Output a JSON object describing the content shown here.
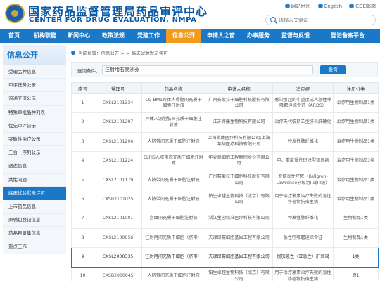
{
  "header": {
    "title_cn": "国家药品监督管理局药品审评中心",
    "title_en": "CENTER FOR DRUG EVALUATION, NMPA",
    "links": [
      "网站地图",
      "English",
      "CDE邮箱"
    ],
    "search_placeholder": "请输入关键词"
  },
  "nav": [
    {
      "label": "首页",
      "w": 40
    },
    {
      "label": "机构职能",
      "w": 48
    },
    {
      "label": "新闻中心",
      "w": 48
    },
    {
      "label": "政策法规",
      "w": 50
    },
    {
      "label": "党建工作",
      "w": 50
    },
    {
      "label": "信息公开",
      "w": 50
    },
    {
      "label": "申请人之窗",
      "w": 56
    },
    {
      "label": "办事服务",
      "w": 50
    },
    {
      "label": "监督与反馈",
      "w": 56
    },
    {
      "label": "登记备案平台",
      "w": 92
    }
  ],
  "nav_active": 5,
  "sidebar": {
    "title": "信息公开",
    "items": [
      "受理品种信息",
      "审评任务公示",
      "沟通交流公示",
      "特殊审批品种列表",
      "优先审评公示",
      "突破性治疗公示",
      "三合一序列公示",
      "送达信息",
      "共性问题",
      "临床试验默示许可",
      "上市药品信息",
      "原辅包登记信息",
      "药品目录集信息",
      "重点工作"
    ],
    "active": 9
  },
  "breadcrumb": "当前位置：信息公开 > > 临床试验默示许可",
  "query": {
    "label": "查询条件：",
    "value": "注射用右美沙芬",
    "button": "查询"
  },
  "table": {
    "headers": [
      "序号",
      "受理号",
      "药品名称",
      "申请人名称",
      "适应症",
      "注册分类"
    ],
    "rows": [
      [
        "1",
        "CXSL2101334",
        "CG-BM1异体人骨髓间充质干细胞注射液",
        "广州赛莱拉干细胞科技股份有限公司",
        "感染引起的中重度成人急性呼吸窘迫综合征（ARDS）",
        "治疗用生物制品1类"
      ],
      [
        "2",
        "CXSL2101297",
        "异体人源脂肪间充质干细胞注射液",
        "江苏得康生物科技有限公司",
        "治疗失代偿期乙型肝炎肝硬化",
        "治疗用生物制品1类"
      ],
      [
        "3",
        "CXSL2101296",
        "人脐带间充质干细胞注射液",
        "上海莱馥医疗科技有限公司;上海莱馥医疗科技有限公司",
        "特发性肺纤维化",
        "治疗用生物制品1类"
      ],
      [
        "4",
        "CXSL2101224",
        "ELPIS人脐带间充质干细胞注射液",
        "华夏源细胞工程集团股份有限公司",
        "中、重度慢性斑块型银屑病",
        "治疗用生物制品1类"
      ],
      [
        "5",
        "CXSL2101179",
        "人脐带间充质干细胞注射液",
        "广州赛莱拉干细胞科技股份有限公司",
        "脊髓炎性坏死（Kellgren-Lawrence分级为II或III级）",
        "治疗用生物制品1类"
      ],
      [
        "6",
        "CXSB2101025",
        "人脐带间充质干细胞注射液",
        "铂生卓越生物科技（北京）有限公司",
        "用于治疗激素治疗失败的急性移植物抗宿主病",
        "治疗用生物制品1类"
      ],
      [
        "7",
        "CXSL2101001",
        "宫血间充质干细胞注射液",
        "浙江生创精准医疗科技有限公司",
        "特发性肺纤维化",
        "生物制品1类"
      ],
      [
        "8",
        "CXSL2100056",
        "注射用间充质干细胞（脐带）",
        "天津昂赛细胞基因工程有限公司",
        "急性呼吸窘迫综合征",
        "生物制品1类"
      ],
      [
        "9",
        "CXSL2000335",
        "注射用间充质干细胞（脐带）",
        "天津昂赛细胞基因工程有限公司",
        "慢加急性（亚急性）肝衰竭",
        "1类"
      ],
      [
        "10",
        "CXSB2000045",
        "人脐带间充质干细胞注射液",
        "铂生卓越生物科技（北京）有限公司",
        "用于治疗激素治疗失败的急性移植物抗宿主病",
        "原1"
      ]
    ],
    "highlight_row": 8
  }
}
